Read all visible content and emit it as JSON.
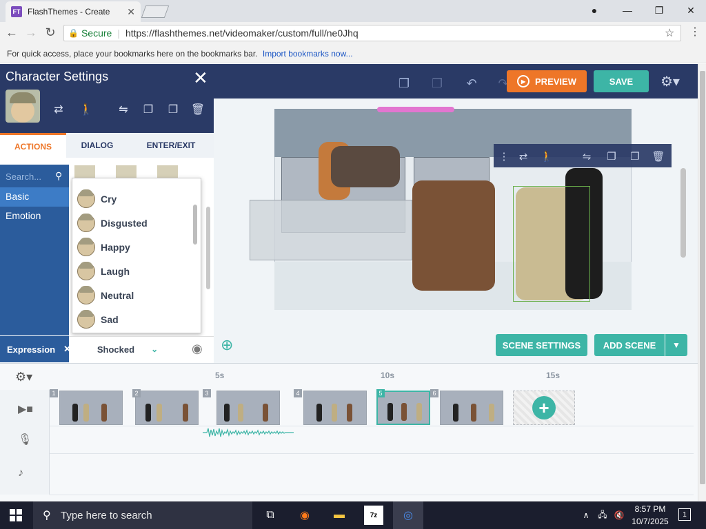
{
  "browser": {
    "tab_title": "FlashThemes - Create",
    "favicon_text": "FT",
    "secure_label": "Secure",
    "url": "https://flashthemes.net/videomaker/custom/full/ne0Jhq",
    "bookmarks_text": "For quick access, place your bookmarks here on the bookmarks bar.",
    "bookmarks_link": "Import bookmarks now..."
  },
  "toolbar": {
    "preview_label": "PREVIEW",
    "save_label": "SAVE"
  },
  "character_settings": {
    "title": "Character Settings",
    "tabs": [
      "ACTIONS",
      "DIALOG",
      "ENTER/EXIT"
    ],
    "active_tab": "ACTIONS",
    "search_placeholder": "Search...",
    "categories": [
      "Basic",
      "Emotion"
    ],
    "active_category": "Basic",
    "expressions": [
      "Cry",
      "Disgusted",
      "Happy",
      "Laugh",
      "Neutral",
      "Sad"
    ],
    "expression_label": "Expression",
    "expression_value": "Shocked"
  },
  "stage": {
    "scene_settings_label": "SCENE SETTINGS",
    "add_scene_label": "ADD SCENE"
  },
  "timeline": {
    "marks": [
      "5s",
      "10s",
      "15s"
    ],
    "scene_numbers": [
      "1",
      "2",
      "3",
      "4",
      "5",
      "6"
    ],
    "selected_scene": "5"
  },
  "taskbar": {
    "search_placeholder": "Type here to search",
    "time": "8:57 PM",
    "date": "10/7/2025",
    "notification_count": "1"
  },
  "colors": {
    "navy": "#2a3a66",
    "teal": "#3db5a6",
    "orange": "#ee7628",
    "blue": "#2b5c9c"
  }
}
